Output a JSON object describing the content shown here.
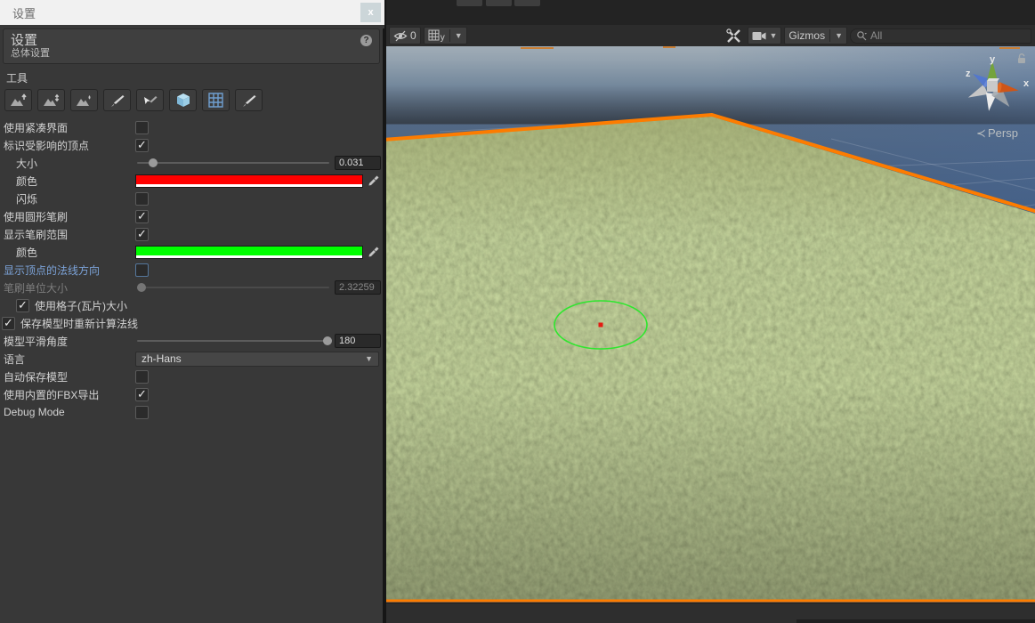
{
  "window": {
    "title": "设置",
    "close_label": "x"
  },
  "panel": {
    "header": {
      "title": "设置",
      "subtitle": "总体设置",
      "help_icon": "?"
    },
    "tools_label": "工具",
    "tools": [
      "raise-terrain",
      "adjust-height",
      "paint-height",
      "paint-brush",
      "select-brush",
      "voxel-cube",
      "grid-tiles",
      "smooth-brush"
    ]
  },
  "settings": {
    "use_compact_ui": {
      "label": "使用紧凑界面",
      "checked": false
    },
    "mark_vertices": {
      "label": "标识受影响的顶点",
      "checked": true
    },
    "size": {
      "label": "大小",
      "value": "0.031"
    },
    "color_red": {
      "label": "颜色",
      "color": "#ff0000"
    },
    "flash": {
      "label": "闪烁",
      "checked": false
    },
    "round_brush": {
      "label": "使用圆形笔刷",
      "checked": true
    },
    "show_brush_range": {
      "label": "显示笔刷范围",
      "checked": true
    },
    "color_green": {
      "label": "颜色",
      "color": "#00ff00"
    },
    "show_vertex_normals": {
      "label": "显示顶点的法线方向",
      "checked": false,
      "accent": "#7ca3d9"
    },
    "brush_unit_size": {
      "label": "笔刷单位大小",
      "value": "2.32259",
      "disabled": true
    },
    "use_tile_size": {
      "label": "使用格子(瓦片)大小",
      "checked": true
    },
    "recalc_normals": {
      "label": "保存模型时重新计算法线",
      "checked": true
    },
    "smooth_angle": {
      "label": "模型平滑角度",
      "value": "180"
    },
    "language": {
      "label": "语言",
      "value": "zh-Hans"
    },
    "auto_save": {
      "label": "自动保存模型",
      "checked": false
    },
    "builtin_fbx": {
      "label": "使用内置的FBX导出",
      "checked": true
    },
    "debug_mode": {
      "label": "Debug Mode",
      "checked": false
    }
  },
  "scene_toolbar": {
    "hidden_objects_count": "0",
    "grid_axis_label": "y",
    "gizmos_label": "Gizmos",
    "search_placeholder": "All"
  },
  "scene": {
    "gizmo": {
      "x": "x",
      "y": "y",
      "z": "z",
      "chevron": "≺",
      "projection": "Persp"
    },
    "colors": {
      "selection_outline": "#fd7c00",
      "brush_circle": "#2ee62e",
      "brush_center": "#e31b12",
      "grass_base": "#6a7547",
      "water_deep": "#3a4f6b"
    }
  }
}
